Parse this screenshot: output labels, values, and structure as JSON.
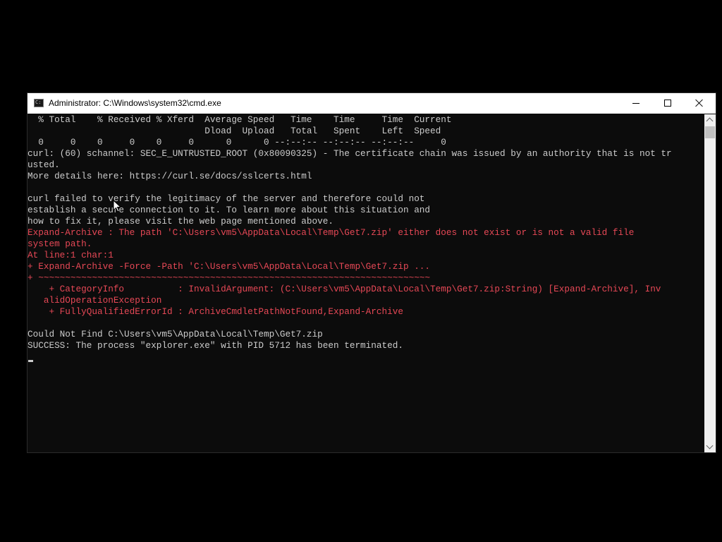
{
  "window": {
    "title": "Administrator: C:\\Windows\\system32\\cmd.exe",
    "icon": "cmd-icon",
    "controls": {
      "minimize": "minimize-icon",
      "maximize": "maximize-icon",
      "close": "close-icon"
    }
  },
  "console": {
    "lines": [
      {
        "text": "  % Total    % Received % Xferd  Average Speed   Time    Time     Time  Current",
        "style": "normal"
      },
      {
        "text": "                                 Dload  Upload   Total   Spent    Left  Speed",
        "style": "normal"
      },
      {
        "text": "  0     0    0     0    0     0      0      0 --:--:-- --:--:-- --:--:--     0",
        "style": "normal"
      },
      {
        "text": "curl: (60) schannel: SEC_E_UNTRUSTED_ROOT (0x80090325) - The certificate chain was issued by an authority that is not tr",
        "style": "normal"
      },
      {
        "text": "usted.",
        "style": "normal"
      },
      {
        "text": "More details here: https://curl.se/docs/sslcerts.html",
        "style": "normal"
      },
      {
        "text": "",
        "style": "normal"
      },
      {
        "text": "curl failed to verify the legitimacy of the server and therefore could not",
        "style": "normal"
      },
      {
        "text": "establish a secure connection to it. To learn more about this situation and",
        "style": "normal"
      },
      {
        "text": "how to fix it, please visit the web page mentioned above.",
        "style": "normal"
      },
      {
        "text": "Expand-Archive : The path 'C:\\Users\\vm5\\AppData\\Local\\Temp\\Get7.zip' either does not exist or is not a valid file",
        "style": "error"
      },
      {
        "text": "system path.",
        "style": "error"
      },
      {
        "text": "At line:1 char:1",
        "style": "error"
      },
      {
        "text": "+ Expand-Archive -Force -Path 'C:\\Users\\vm5\\AppData\\Local\\Temp\\Get7.zip ...",
        "style": "error"
      },
      {
        "text": "+ ~~~~~~~~~~~~~~~~~~~~~~~~~~~~~~~~~~~~~~~~~~~~~~~~~~~~~~~~~~~~~~~~~~~~~~~~~",
        "style": "error"
      },
      {
        "text": "    + CategoryInfo          : InvalidArgument: (C:\\Users\\vm5\\AppData\\Local\\Temp\\Get7.zip:String) [Expand-Archive], Inv",
        "style": "error"
      },
      {
        "text": "   alidOperationException",
        "style": "error"
      },
      {
        "text": "    + FullyQualifiedErrorId : ArchiveCmdletPathNotFound,Expand-Archive",
        "style": "error"
      },
      {
        "text": "",
        "style": "normal"
      },
      {
        "text": "Could Not Find C:\\Users\\vm5\\AppData\\Local\\Temp\\Get7.zip",
        "style": "normal"
      },
      {
        "text": "SUCCESS: The process \"explorer.exe\" with PID 5712 has been terminated.",
        "style": "normal"
      }
    ]
  },
  "colors": {
    "console_background": "#0c0c0c",
    "console_text": "#cccccc",
    "error_text": "#e74856",
    "titlebar": "#ffffff",
    "desktop": "#000000"
  }
}
